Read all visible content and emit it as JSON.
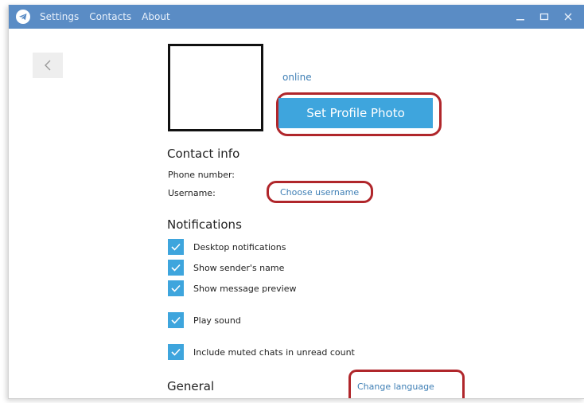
{
  "menu": {
    "items": [
      "Settings",
      "Contacts",
      "About"
    ]
  },
  "profile": {
    "status": "online",
    "set_photo_label": "Set Profile Photo"
  },
  "contact_info": {
    "title": "Contact info",
    "phone_label": "Phone number:",
    "username_label": "Username:",
    "username_link": "Choose username"
  },
  "notifications": {
    "title": "Notifications",
    "items": [
      {
        "label": "Desktop notifications",
        "checked": true
      },
      {
        "label": "Show sender's name",
        "checked": true
      },
      {
        "label": "Show message preview",
        "checked": true
      },
      {
        "label": "Play sound",
        "checked": true
      },
      {
        "label": "Include muted chats in unread count",
        "checked": true
      }
    ]
  },
  "general": {
    "title": "General",
    "change_language": "Change language"
  },
  "colors": {
    "titlebar": "#5a8cc5",
    "accent": "#3ea5dd",
    "link": "#3f7fb5",
    "highlight": "#b0262b"
  },
  "icons": {
    "app": "telegram-plane-icon",
    "back": "chevron-left-icon",
    "minimize": "minimize-icon",
    "maximize": "maximize-icon",
    "close": "close-icon",
    "check": "checkmark-icon"
  }
}
